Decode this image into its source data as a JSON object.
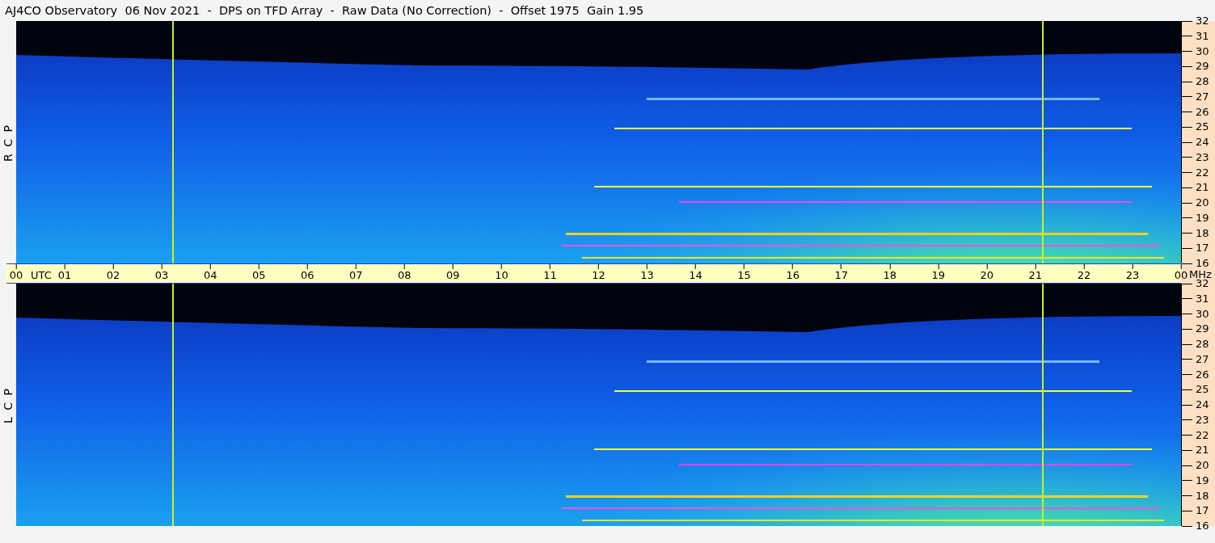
{
  "title": "AJ4CO Observatory  06 Nov 2021  -  DPS on TFD Array  -  Raw Data (No Correction)  -  Offset 1975  Gain 1.95",
  "panels": [
    {
      "polarization": "R C P",
      "freq_ticks": [
        "32",
        "31",
        "30",
        "29",
        "28",
        "27",
        "26",
        "25",
        "24",
        "23",
        "22",
        "21",
        "20",
        "19",
        "18",
        "17",
        "16"
      ]
    },
    {
      "polarization": "L C P",
      "freq_ticks": [
        "32",
        "31",
        "30",
        "29",
        "28",
        "27",
        "26",
        "25",
        "24",
        "23",
        "22",
        "21",
        "20",
        "19",
        "18",
        "17",
        "16"
      ]
    }
  ],
  "time_axis": {
    "labels": [
      "00",
      "01",
      "02",
      "03",
      "04",
      "05",
      "06",
      "07",
      "08",
      "09",
      "10",
      "11",
      "12",
      "13",
      "14",
      "15",
      "16",
      "17",
      "18",
      "19",
      "20",
      "21",
      "22",
      "23",
      "00"
    ],
    "zone": "UTC",
    "unit": "MHz"
  }
}
